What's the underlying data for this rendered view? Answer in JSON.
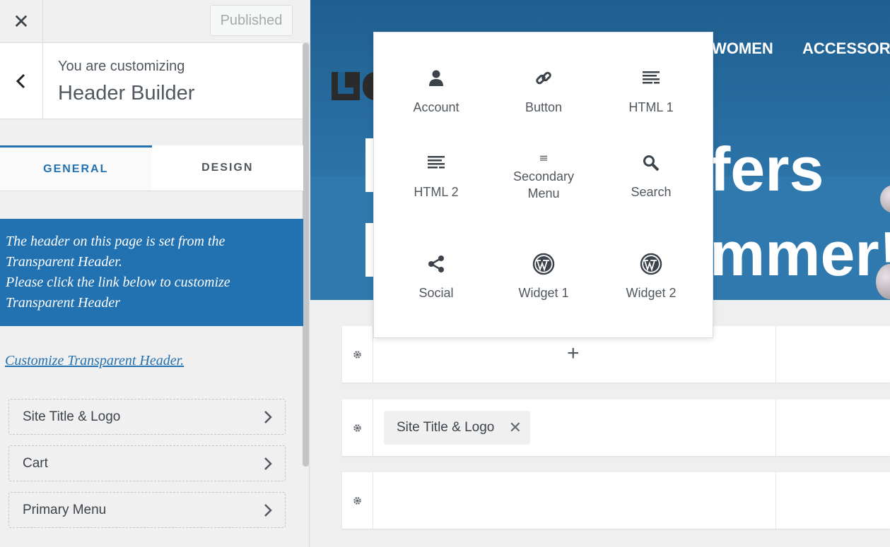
{
  "topbar": {
    "close_icon": "close-icon",
    "published_label": "Published"
  },
  "section": {
    "customizing_label": "You are customizing",
    "title": "Header Builder"
  },
  "tabs": [
    {
      "label": "GENERAL",
      "active": true
    },
    {
      "label": "DESIGN",
      "active": false
    }
  ],
  "notice": {
    "line1": "The header on this page is set from the",
    "line2": "Transparent Header.",
    "line3": "Please click the link below to customize",
    "line4": "Transparent Header"
  },
  "customize_link": "Customize Transparent Header.",
  "items": [
    {
      "label": "Site Title & Logo"
    },
    {
      "label": "Cart"
    },
    {
      "label": "Primary Menu"
    }
  ],
  "preview": {
    "nav": [
      "WOMEN",
      "ACCESSORIE"
    ],
    "hero_line1": "fers",
    "hero_line2": "mmer!",
    "add_symbol": "+",
    "chip_label": "Site Title & Logo",
    "chip_remove": "✕"
  },
  "popup": {
    "items": [
      {
        "label": "Account",
        "icon": "account-icon"
      },
      {
        "label": "Button",
        "icon": "link-icon"
      },
      {
        "label": "HTML 1",
        "icon": "text-align-icon"
      },
      {
        "label": "HTML 2",
        "icon": "text-align-icon"
      },
      {
        "label": "Secondary Menu",
        "icon": "menu-icon"
      },
      {
        "label": "Search",
        "icon": "search-icon"
      },
      {
        "label": "Social",
        "icon": "share-icon"
      },
      {
        "label": "Widget 1",
        "icon": "wordpress-icon"
      },
      {
        "label": "Widget 2",
        "icon": "wordpress-icon"
      }
    ]
  },
  "colors": {
    "accent": "#2271b1",
    "hero": "#2c74a9"
  }
}
